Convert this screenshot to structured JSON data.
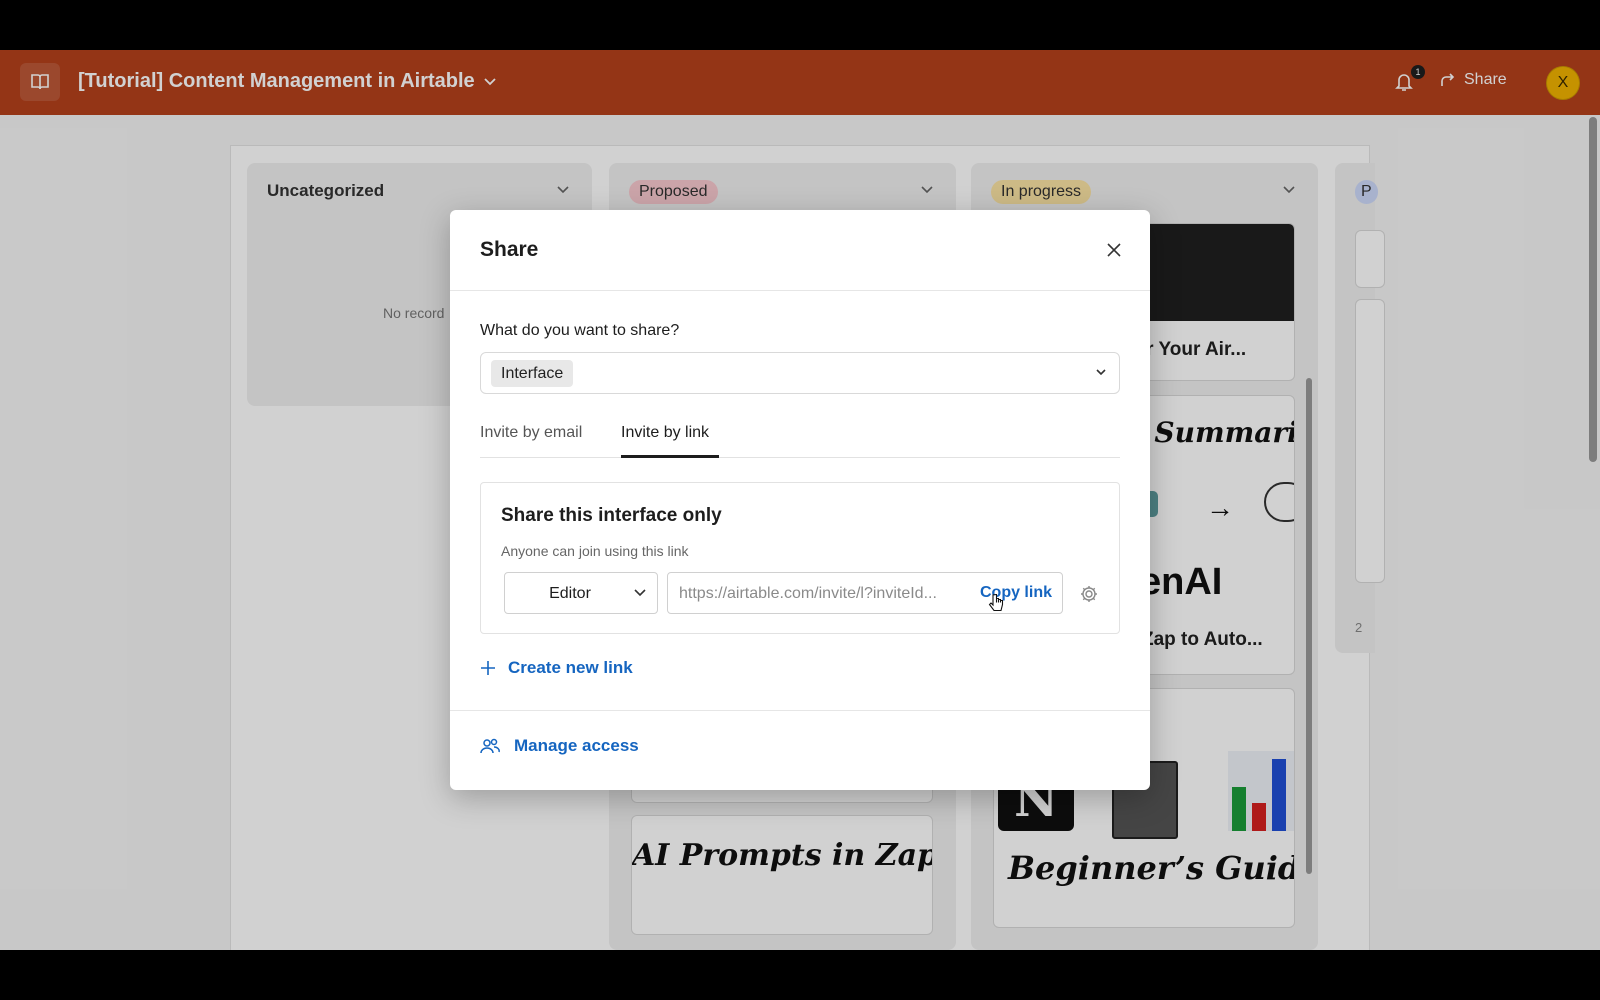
{
  "header": {
    "base_title": "[Tutorial] Content Management in Airtable",
    "notification_count": "1",
    "share_label": "Share",
    "avatar_initial": "X",
    "colors": {
      "header_bg": "#b5411c",
      "avatar_bg": "#f1b300"
    }
  },
  "board": {
    "columns": [
      {
        "label": "Uncategorized",
        "empty_text": "No record"
      },
      {
        "label": "Proposed",
        "pill_color": "#f8c9cf"
      },
      {
        "label": "In progress",
        "pill_color": "#fbe3a4"
      },
      {
        "label": "P",
        "pill_color": "#cdd9fb"
      }
    ],
    "cards": {
      "card_1_title": "ger Your Air...",
      "card_2_heading": "l Summarie",
      "card_2_brand": "enAI",
      "card_2_title": "Zap to Auto...",
      "card_3_heading": "Beginner’s Guide",
      "proposed_card_heading": "AI Prompts in Zapier",
      "p_column_count": "2"
    }
  },
  "modal": {
    "title": "Share",
    "question": "What do you want to share?",
    "selected_item": "Interface",
    "tabs": [
      {
        "label": "Invite by email",
        "active": false
      },
      {
        "label": "Invite by link",
        "active": true
      }
    ],
    "panel": {
      "title": "Share this interface only",
      "subtitle": "Anyone can join using this link",
      "role": "Editor",
      "link_url": "https://airtable.com/invite/l?inviteId...",
      "copy_label": "Copy link"
    },
    "create_link_label": "Create new link",
    "manage_access_label": "Manage access",
    "colors": {
      "link_blue": "#1565c0"
    }
  }
}
